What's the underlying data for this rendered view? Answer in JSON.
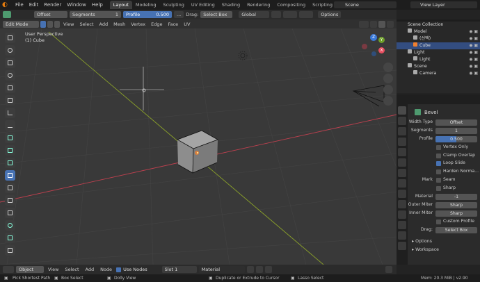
{
  "menus": [
    "File",
    "Edit",
    "Render",
    "Window",
    "Help"
  ],
  "workspaces": [
    {
      "label": "Layout",
      "active": true
    },
    {
      "label": "Modeling",
      "active": false
    },
    {
      "label": "Sculpting",
      "active": false
    },
    {
      "label": "UV Editing",
      "active": false
    },
    {
      "label": "Shading",
      "active": false
    },
    {
      "label": "Rendering",
      "active": false
    },
    {
      "label": "Compositing",
      "active": false
    },
    {
      "label": "Scripting",
      "active": false
    }
  ],
  "scene": "Scene",
  "view_layer": "View Layer",
  "tool_header": {
    "width_type": "Offset",
    "segments_label": "Segments",
    "segments_value": "1",
    "profile_label": "Profile",
    "profile_value": "0.500",
    "ellipsis": "...",
    "drag_label": "Drag:",
    "drag_value": "Select Box",
    "orientation": "Global",
    "options": "Options"
  },
  "viewport_header": {
    "mode": "Edit Mode",
    "menus": [
      "View",
      "Select",
      "Add",
      "Mesh",
      "Vertex",
      "Edge",
      "Face",
      "UV"
    ]
  },
  "viewport": {
    "perspective": "User Perspective",
    "object": "(1) Cube",
    "axis_x": "X",
    "axis_y": "Y",
    "axis_z": "Z"
  },
  "outliner": {
    "collection": "Scene Collection",
    "items": [
      {
        "label": "Model",
        "indent": 1,
        "selected": false
      },
      {
        "label": "(선택)",
        "indent": 2,
        "selected": false
      },
      {
        "label": "Cube",
        "indent": 2,
        "selected": true
      },
      {
        "label": "Light",
        "indent": 1,
        "selected": false
      },
      {
        "label": "Light",
        "indent": 2,
        "selected": false
      },
      {
        "label": "Scene",
        "indent": 1,
        "selected": false
      },
      {
        "label": "Camera",
        "indent": 2,
        "selected": false
      }
    ]
  },
  "properties": {
    "title": "Bevel",
    "width_type_label": "Width Type",
    "width_type_value": "Offset",
    "segments_label": "Segments",
    "segments_value": "1",
    "profile_label": "Profile",
    "profile_value": "0.500",
    "profile_fraction": 0.5,
    "checks": [
      {
        "label": "Vertex Only",
        "on": false
      },
      {
        "label": "Clamp Overlap",
        "on": false
      },
      {
        "label": "Loop Slide",
        "on": true
      },
      {
        "label": "Harden Norma...",
        "on": false
      }
    ],
    "mark_label": "Mark",
    "seam_label": "Seam",
    "sharp_label": "Sharp",
    "material_label": "Material",
    "material_value": "-1",
    "outer_miter_label": "Outer Miter",
    "outer_miter_value": "Sharp",
    "inner_miter_label": "Inner Miter",
    "inner_miter_value": "Sharp",
    "custom_profile_label": "Custom Profile",
    "drag_label": "Drag:",
    "drag_value": "Select Box",
    "options_panel": "Options",
    "workspace_panel": "Workspace"
  },
  "bottom_header": {
    "editor": "Object",
    "menus": [
      "View",
      "Select",
      "Add",
      "Node"
    ],
    "use_nodes": "Use Nodes",
    "slot": "Slot 1",
    "material": "Material"
  },
  "status": {
    "s1": "Pick Shortest Path",
    "s2": "Box Select",
    "s3": "Dolly View",
    "s4": "Duplicate or Extrude to Cursor",
    "s5": "Lasso Select",
    "mem": "Mem: 20.3 MiB | v2.90"
  },
  "colors": {
    "accent": "#4772b3",
    "x_axis": "#c0404f",
    "y_axis": "#8aa02a",
    "vertex": "#f08030"
  }
}
